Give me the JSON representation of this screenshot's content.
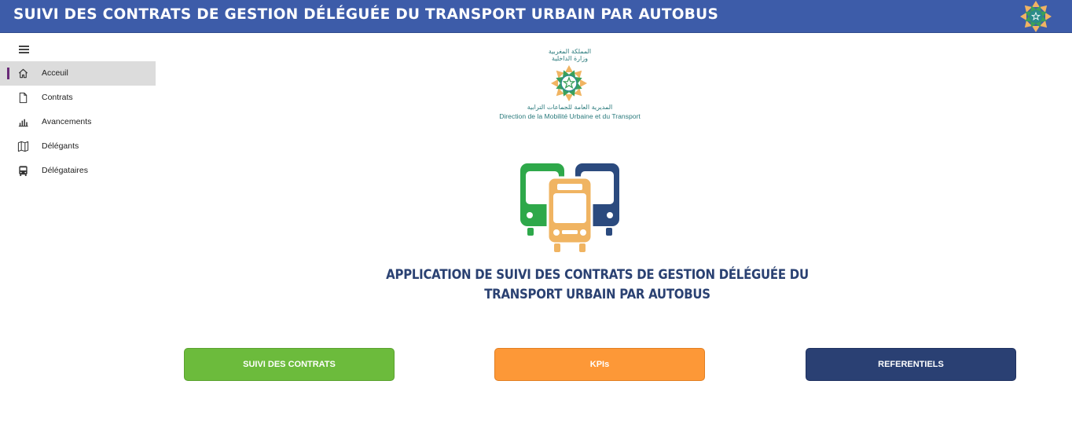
{
  "header": {
    "title": "SUIVI DES CONTRATS DE GESTION DÉLÉGUÉE DU TRANSPORT URBAIN PAR AUTOBUS",
    "emblem_icon": "morocco-ministry-star-emblem",
    "background_color": "#3d5ca9"
  },
  "sidebar": {
    "menu_icon": "hamburger-menu-icon",
    "items": [
      {
        "label": "Acceuil",
        "icon": "home-icon",
        "active": true
      },
      {
        "label": "Contrats",
        "icon": "document-icon",
        "active": false
      },
      {
        "label": "Avancements",
        "icon": "bar-chart-icon",
        "active": false
      },
      {
        "label": "Délégants",
        "icon": "map-icon",
        "active": false
      },
      {
        "label": "Délégataires",
        "icon": "bus-icon",
        "active": false
      }
    ],
    "active_marker_color": "#6a2b78"
  },
  "ministry": {
    "arabic_kingdom": "المملكة المغربية",
    "arabic_ministry": "وزارة الداخلية",
    "arabic_directorate": "المديرية العامة للجماعات الترابية",
    "french_directorate": "Direction de la Mobilité Urbaine et du Transport"
  },
  "main": {
    "illustration_icon": "three-buses-illustration",
    "title_line1": "APPLICATION DE SUIVI DES CONTRATS DE GESTION DÉLÉGUÉE DU",
    "title_line2": "TRANSPORT URBAIN PAR AUTOBUS",
    "title_color": "#2a4172"
  },
  "buttons": {
    "suivi_label": "SUIVI DES CONTRATS",
    "kpis_label": "KPIs",
    "referentiels_label": "REFERENTIELS",
    "colors": {
      "green": "#6cbb3c",
      "orange": "#fd9837",
      "navy": "#2a4073"
    }
  }
}
